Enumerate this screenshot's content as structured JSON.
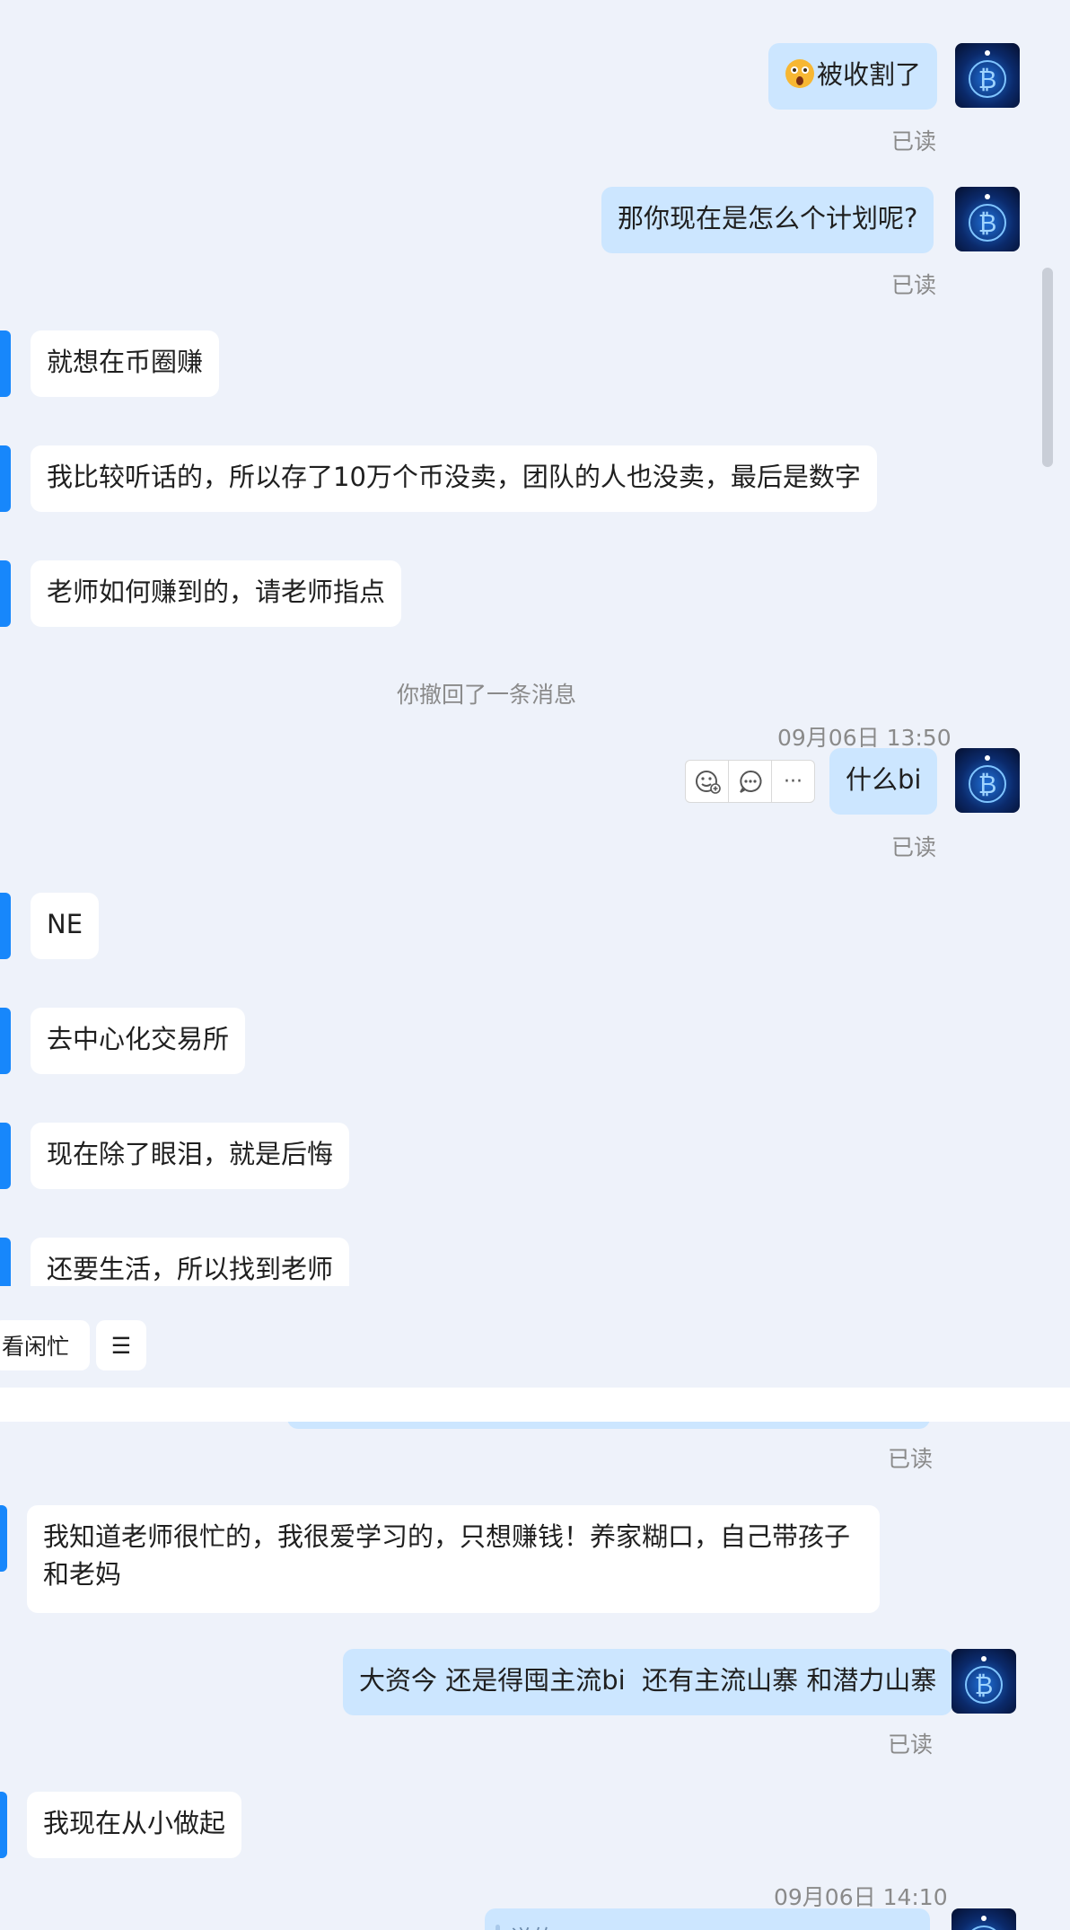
{
  "top_panel": {
    "messages": [
      {
        "id": "m1",
        "dir": "out",
        "text": "被收割了",
        "emoji": "astonished-face",
        "read": "已读"
      },
      {
        "id": "m2",
        "dir": "out",
        "text": "那你现在是怎么个计划呢?",
        "read": "已读"
      },
      {
        "id": "m3",
        "dir": "in",
        "text": "就想在币圈赚"
      },
      {
        "id": "m4",
        "dir": "in",
        "text": "我比较听话的，所以存了10万个币没卖，团队的人也没卖，最后是数字"
      },
      {
        "id": "m5",
        "dir": "in",
        "text": "老师如何赚到的，请老师指点"
      },
      {
        "id": "m6",
        "dir": "out",
        "text": "什么bi",
        "timestamp": "09月06日 13:50",
        "read": "已读"
      },
      {
        "id": "m7",
        "dir": "in",
        "text": "NE"
      },
      {
        "id": "m8",
        "dir": "in",
        "text": "去中心化交易所"
      },
      {
        "id": "m9",
        "dir": "in",
        "text": "现在除了眼泪，就是后悔"
      },
      {
        "id": "m10",
        "dir": "in",
        "text": "还要生活，所以找到老师"
      }
    ],
    "system_message": "你撤回了一条消息",
    "hover_toolbar": {
      "icons": [
        "emoji-add-icon",
        "comment-icon",
        "more-icon"
      ],
      "more_label": "···"
    },
    "quick_chips": {
      "first_label": "看闲忙",
      "menu_label": "☰"
    }
  },
  "bottom_panel": {
    "read_1": "已读",
    "messages": [
      {
        "id": "b1",
        "dir": "in",
        "text": "我知道老师很忙的，我很爱学习的，只想赚钱！养家糊口，自己带孩子和老妈"
      },
      {
        "id": "b2",
        "dir": "out",
        "text": "大资今 还是得囤主流bi  还有主流山寨 和潜力山寨",
        "read": "已读"
      },
      {
        "id": "b3",
        "dir": "in",
        "text": "我现在从小做起"
      },
      {
        "id": "b4",
        "dir": "out",
        "timestamp": "09月06日 14:10",
        "quote": "说的"
      }
    ]
  },
  "colors": {
    "page_bg": "#eef2fa",
    "incoming_bubble": "#ffffff",
    "outgoing_bubble": "#cce6ff",
    "accent": "#1787fb",
    "meta_text": "#8a8a8a"
  }
}
